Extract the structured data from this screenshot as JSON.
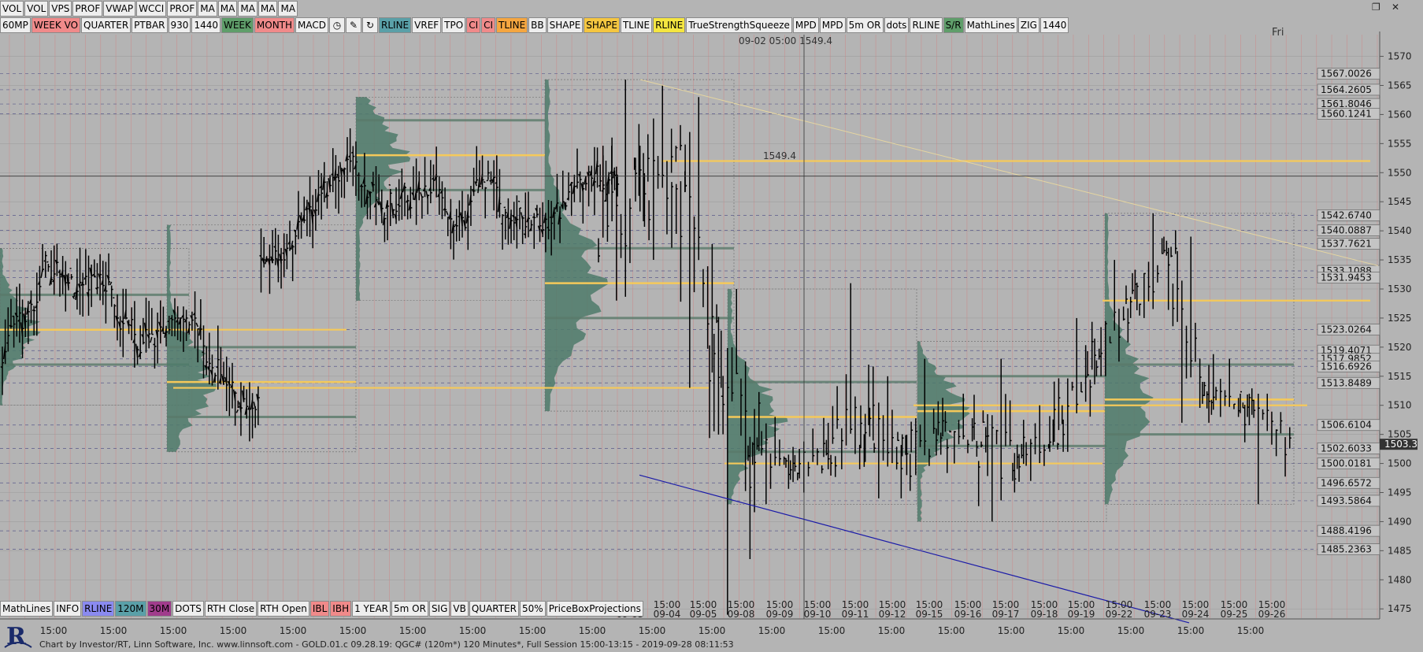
{
  "toolbar_top_1": [
    "VOL",
    "VOL",
    "VPS",
    "PROF",
    "VWAP",
    "WCCI",
    "PROF",
    "MA",
    "MA",
    "MA",
    "MA",
    "MA"
  ],
  "toolbar_top_2": [
    {
      "label": "60MP",
      "bg": "#eeeeee"
    },
    {
      "label": "WEEK VO",
      "bg": "#f08a8a"
    },
    {
      "label": "QUARTER",
      "bg": "#eeeeee"
    },
    {
      "label": "PTBAR",
      "bg": "#eeeeee"
    },
    {
      "label": "930",
      "bg": "#eeeeee"
    },
    {
      "label": "1440",
      "bg": "#eeeeee"
    },
    {
      "label": "WEEK",
      "bg": "#5f9e6a"
    },
    {
      "label": "MONTH",
      "bg": "#f08a8a"
    },
    {
      "label": "MACD",
      "bg": "#eeeeee"
    },
    {
      "icon": "clock-icon"
    },
    {
      "icon": "pencil-icon"
    },
    {
      "icon": "refresh-icon"
    },
    {
      "label": "RLINE",
      "bg": "#5aa0a8"
    },
    {
      "label": "VREF",
      "bg": "#eeeeee"
    },
    {
      "label": "TPO",
      "bg": "#eeeeee"
    },
    {
      "label": "CI",
      "bg": "#f08a8a"
    },
    {
      "label": "CI",
      "bg": "#f08a8a"
    },
    {
      "label": "TLINE",
      "bg": "#f5a640"
    },
    {
      "label": "BB",
      "bg": "#eeeeee"
    },
    {
      "label": "SHAPE",
      "bg": "#eeeeee"
    },
    {
      "label": "SHAPE",
      "bg": "#f5c640"
    },
    {
      "label": "TLINE",
      "bg": "#eeeeee"
    },
    {
      "label": "RLINE",
      "bg": "#f5e640"
    },
    {
      "label": "TrueStrengthSqueeze",
      "bg": "#eeeeee"
    },
    {
      "label": "MPD",
      "bg": "#eeeeee"
    },
    {
      "label": "MPD",
      "bg": "#eeeeee"
    },
    {
      "label": "5m OR",
      "bg": "#eeeeee"
    },
    {
      "label": "dots",
      "bg": "#eeeeee"
    },
    {
      "label": "RLINE",
      "bg": "#eeeeee"
    },
    {
      "label": "S/R",
      "bg": "#5f9e6a"
    },
    {
      "label": "MathLines",
      "bg": "#eeeeee"
    },
    {
      "label": "ZIG",
      "bg": "#eeeeee"
    },
    {
      "label": "1440",
      "bg": "#eeeeee"
    }
  ],
  "toolbar_bottom": [
    {
      "label": "MathLines",
      "bg": "#eeeeee"
    },
    {
      "label": "INFO",
      "bg": "#eeeeee"
    },
    {
      "label": "RLINE",
      "bg": "#8a8af0"
    },
    {
      "label": "120M",
      "bg": "#5aa0a8"
    },
    {
      "label": "30M",
      "bg": "#a03c8c"
    },
    {
      "label": "DOTS",
      "bg": "#eeeeee"
    },
    {
      "label": "RTH Close",
      "bg": "#eeeeee"
    },
    {
      "label": "RTH Open",
      "bg": "#eeeeee"
    },
    {
      "label": "IBL",
      "bg": "#f08a8a"
    },
    {
      "label": "IBH",
      "bg": "#f08a8a"
    },
    {
      "label": "1 YEAR",
      "bg": "#eeeeee"
    },
    {
      "label": "5m OR",
      "bg": "#eeeeee"
    },
    {
      "label": "SIG",
      "bg": "#eeeeee"
    },
    {
      "label": "VB",
      "bg": "#eeeeee"
    },
    {
      "label": "QUARTER",
      "bg": "#eeeeee"
    },
    {
      "label": "50%",
      "bg": "#eeeeee"
    },
    {
      "label": "PriceBoxProjections",
      "bg": "#eeeeee"
    }
  ],
  "day_label": "Fri",
  "crosshair_readout": "09-02 05:00   1549.4",
  "price_readout": "1549.4",
  "last_price": "1503.3",
  "footer_text": "Chart by Investor/RT, Linn Software, Inc. www.linnsoft.com - GOLD.01.c      09.28.19: QGC# (120m*) 120 Minutes*, Full Session 15:00-13:15 - 2019-09-28 08:11:53",
  "chart_data": {
    "type": "bar",
    "instrument": "GOLD.01.c",
    "interval": "120 Minutes",
    "ylim": [
      1473,
      1574
    ],
    "y_ticks": [
      1475,
      1480,
      1485,
      1490,
      1495,
      1500,
      1505,
      1510,
      1515,
      1520,
      1525,
      1530,
      1535,
      1540,
      1545,
      1550,
      1555,
      1560,
      1565,
      1570
    ],
    "grid": true,
    "date_labels": [
      "09-03",
      "09-04",
      "09-05",
      "09-08",
      "09-09",
      "09-10",
      "09-11",
      "09-12",
      "09-15",
      "09-16",
      "09-17",
      "09-18",
      "09-19",
      "09-22",
      "09-23",
      "09-24",
      "09-25",
      "09-26"
    ],
    "time_label": "15:00",
    "sessions": [
      {
        "date": "09-03",
        "open": 1541,
        "high": 1566,
        "low": 1528,
        "close": 1546
      },
      {
        "date": "09-04",
        "open": 1546,
        "high": 1565,
        "low": 1535,
        "close": 1550
      },
      {
        "date": "09-05",
        "open": 1551,
        "high": 1563,
        "low": 1513,
        "close": 1516
      },
      {
        "date": "09-08",
        "open": 1516,
        "high": 1530,
        "low": 1474,
        "close": 1503
      },
      {
        "date": "09-09",
        "open": 1503,
        "high": 1508,
        "low": 1493,
        "close": 1500
      },
      {
        "date": "09-10",
        "open": 1500,
        "high": 1506,
        "low": 1495,
        "close": 1501
      },
      {
        "date": "09-11",
        "open": 1501,
        "high": 1531,
        "low": 1499,
        "close": 1507
      },
      {
        "date": "09-12",
        "open": 1507,
        "high": 1515,
        "low": 1494,
        "close": 1501
      },
      {
        "date": "09-15",
        "open": 1501,
        "high": 1518,
        "low": 1498,
        "close": 1506
      },
      {
        "date": "09-16",
        "open": 1506,
        "high": 1512,
        "low": 1500,
        "close": 1504
      },
      {
        "date": "09-17",
        "open": 1504,
        "high": 1518,
        "low": 1490,
        "close": 1500
      },
      {
        "date": "09-18",
        "open": 1500,
        "high": 1510,
        "low": 1497,
        "close": 1505
      },
      {
        "date": "09-19",
        "open": 1505,
        "high": 1525,
        "low": 1502,
        "close": 1518
      },
      {
        "date": "09-22",
        "open": 1518,
        "high": 1535,
        "low": 1515,
        "close": 1528
      },
      {
        "date": "09-23",
        "open": 1528,
        "high": 1543,
        "low": 1525,
        "close": 1535
      },
      {
        "date": "09-24",
        "open": 1535,
        "high": 1539,
        "low": 1507,
        "close": 1512
      },
      {
        "date": "09-25",
        "open": 1512,
        "high": 1518,
        "low": 1508,
        "close": 1510
      },
      {
        "date": "09-26",
        "open": 1510,
        "high": 1512,
        "low": 1493,
        "close": 1503
      }
    ],
    "price_levels": [
      {
        "label": "1567.0026",
        "value": 1567.0026
      },
      {
        "label": "1564.2605",
        "value": 1564.2605
      },
      {
        "label": "1561.8046",
        "value": 1561.8046
      },
      {
        "label": "1560.1241",
        "value": 1560.1241
      },
      {
        "label": "1542.6740",
        "value": 1542.674
      },
      {
        "label": "1540.0887",
        "value": 1540.0887
      },
      {
        "label": "1537.7621",
        "value": 1537.7621
      },
      {
        "label": "1533.1088",
        "value": 1533.1088
      },
      {
        "label": "1531.9453",
        "value": 1531.9453
      },
      {
        "label": "1523.0264",
        "value": 1523.0264
      },
      {
        "label": "1519.4071",
        "value": 1519.4071
      },
      {
        "label": "1517.9852",
        "value": 1517.9852
      },
      {
        "label": "1516.6926",
        "value": 1516.6926
      },
      {
        "label": "1513.8489",
        "value": 1513.8489
      },
      {
        "label": "1506.6104",
        "value": 1506.6104
      },
      {
        "label": "1502.6033",
        "value": 1502.6033
      },
      {
        "label": "1500.0181",
        "value": 1500.0181
      },
      {
        "label": "1496.6572",
        "value": 1496.6572
      },
      {
        "label": "1493.5864",
        "value": 1493.5864
      },
      {
        "label": "1488.4196",
        "value": 1488.4196
      },
      {
        "label": "1485.2363",
        "value": 1485.2363
      }
    ],
    "colors": {
      "background": "#b4b4b4",
      "bars": "#000000",
      "profile": "#4e7a6a",
      "poc_line": "#f5c95a",
      "trendline_down": "#1a1aa8",
      "trendline_top": "#e6d6a0"
    }
  }
}
